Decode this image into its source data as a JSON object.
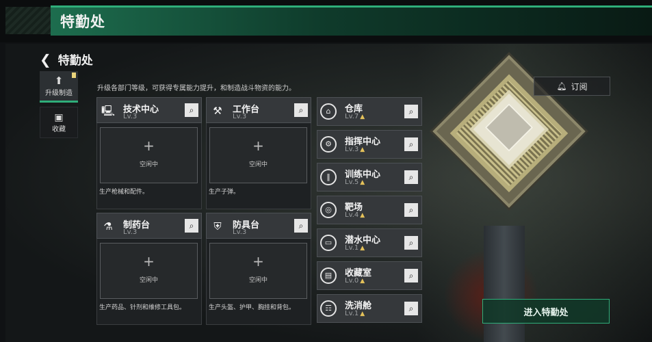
{
  "header": {
    "title": "特勤处"
  },
  "nav": {
    "back_label": "特勤处",
    "subscribe_label": "订阅"
  },
  "tabs": [
    {
      "label": "升级制造",
      "active": true
    },
    {
      "label": "收藏",
      "active": false
    }
  ],
  "description": "升级各部门等级，可获得专属能力提升，和制造战斗物资的能力。",
  "crafting_stations": [
    {
      "name": "技术中心",
      "level": "Lv.3",
      "slot_status": "空闲中",
      "description": "生产枪械和配件。",
      "icon": "computer-icon"
    },
    {
      "name": "工作台",
      "level": "Lv.3",
      "slot_status": "空闲中",
      "description": "生产子弹。",
      "icon": "tools-icon"
    },
    {
      "name": "制药台",
      "level": "Lv.3",
      "slot_status": "空闲中",
      "description": "生产药品、针剂和维修工具包。",
      "icon": "microscope-icon"
    },
    {
      "name": "防具台",
      "level": "Lv.3",
      "slot_status": "空闲中",
      "description": "生产头盔、护甲、胸挂和背包。",
      "icon": "armor-icon"
    }
  ],
  "facilities": [
    {
      "name": "仓库",
      "level": "Lv.7",
      "icon": "warehouse-icon"
    },
    {
      "name": "指挥中心",
      "level": "Lv.3",
      "icon": "command-icon"
    },
    {
      "name": "训练中心",
      "level": "Lv.5",
      "icon": "dumbbell-icon"
    },
    {
      "name": "靶场",
      "level": "Lv.4",
      "icon": "target-icon"
    },
    {
      "name": "潜水中心",
      "level": "Lv.1",
      "icon": "diving-mask-icon"
    },
    {
      "name": "收藏室",
      "level": "Lv.0",
      "icon": "collection-icon"
    },
    {
      "name": "洗消舱",
      "level": "Lv.1",
      "icon": "shower-icon"
    }
  ],
  "enter_button": {
    "label": "进入特勤处"
  },
  "colors": {
    "accent": "#2fae7a",
    "upgrade": "#e4c15a",
    "panel": "#35383b"
  }
}
